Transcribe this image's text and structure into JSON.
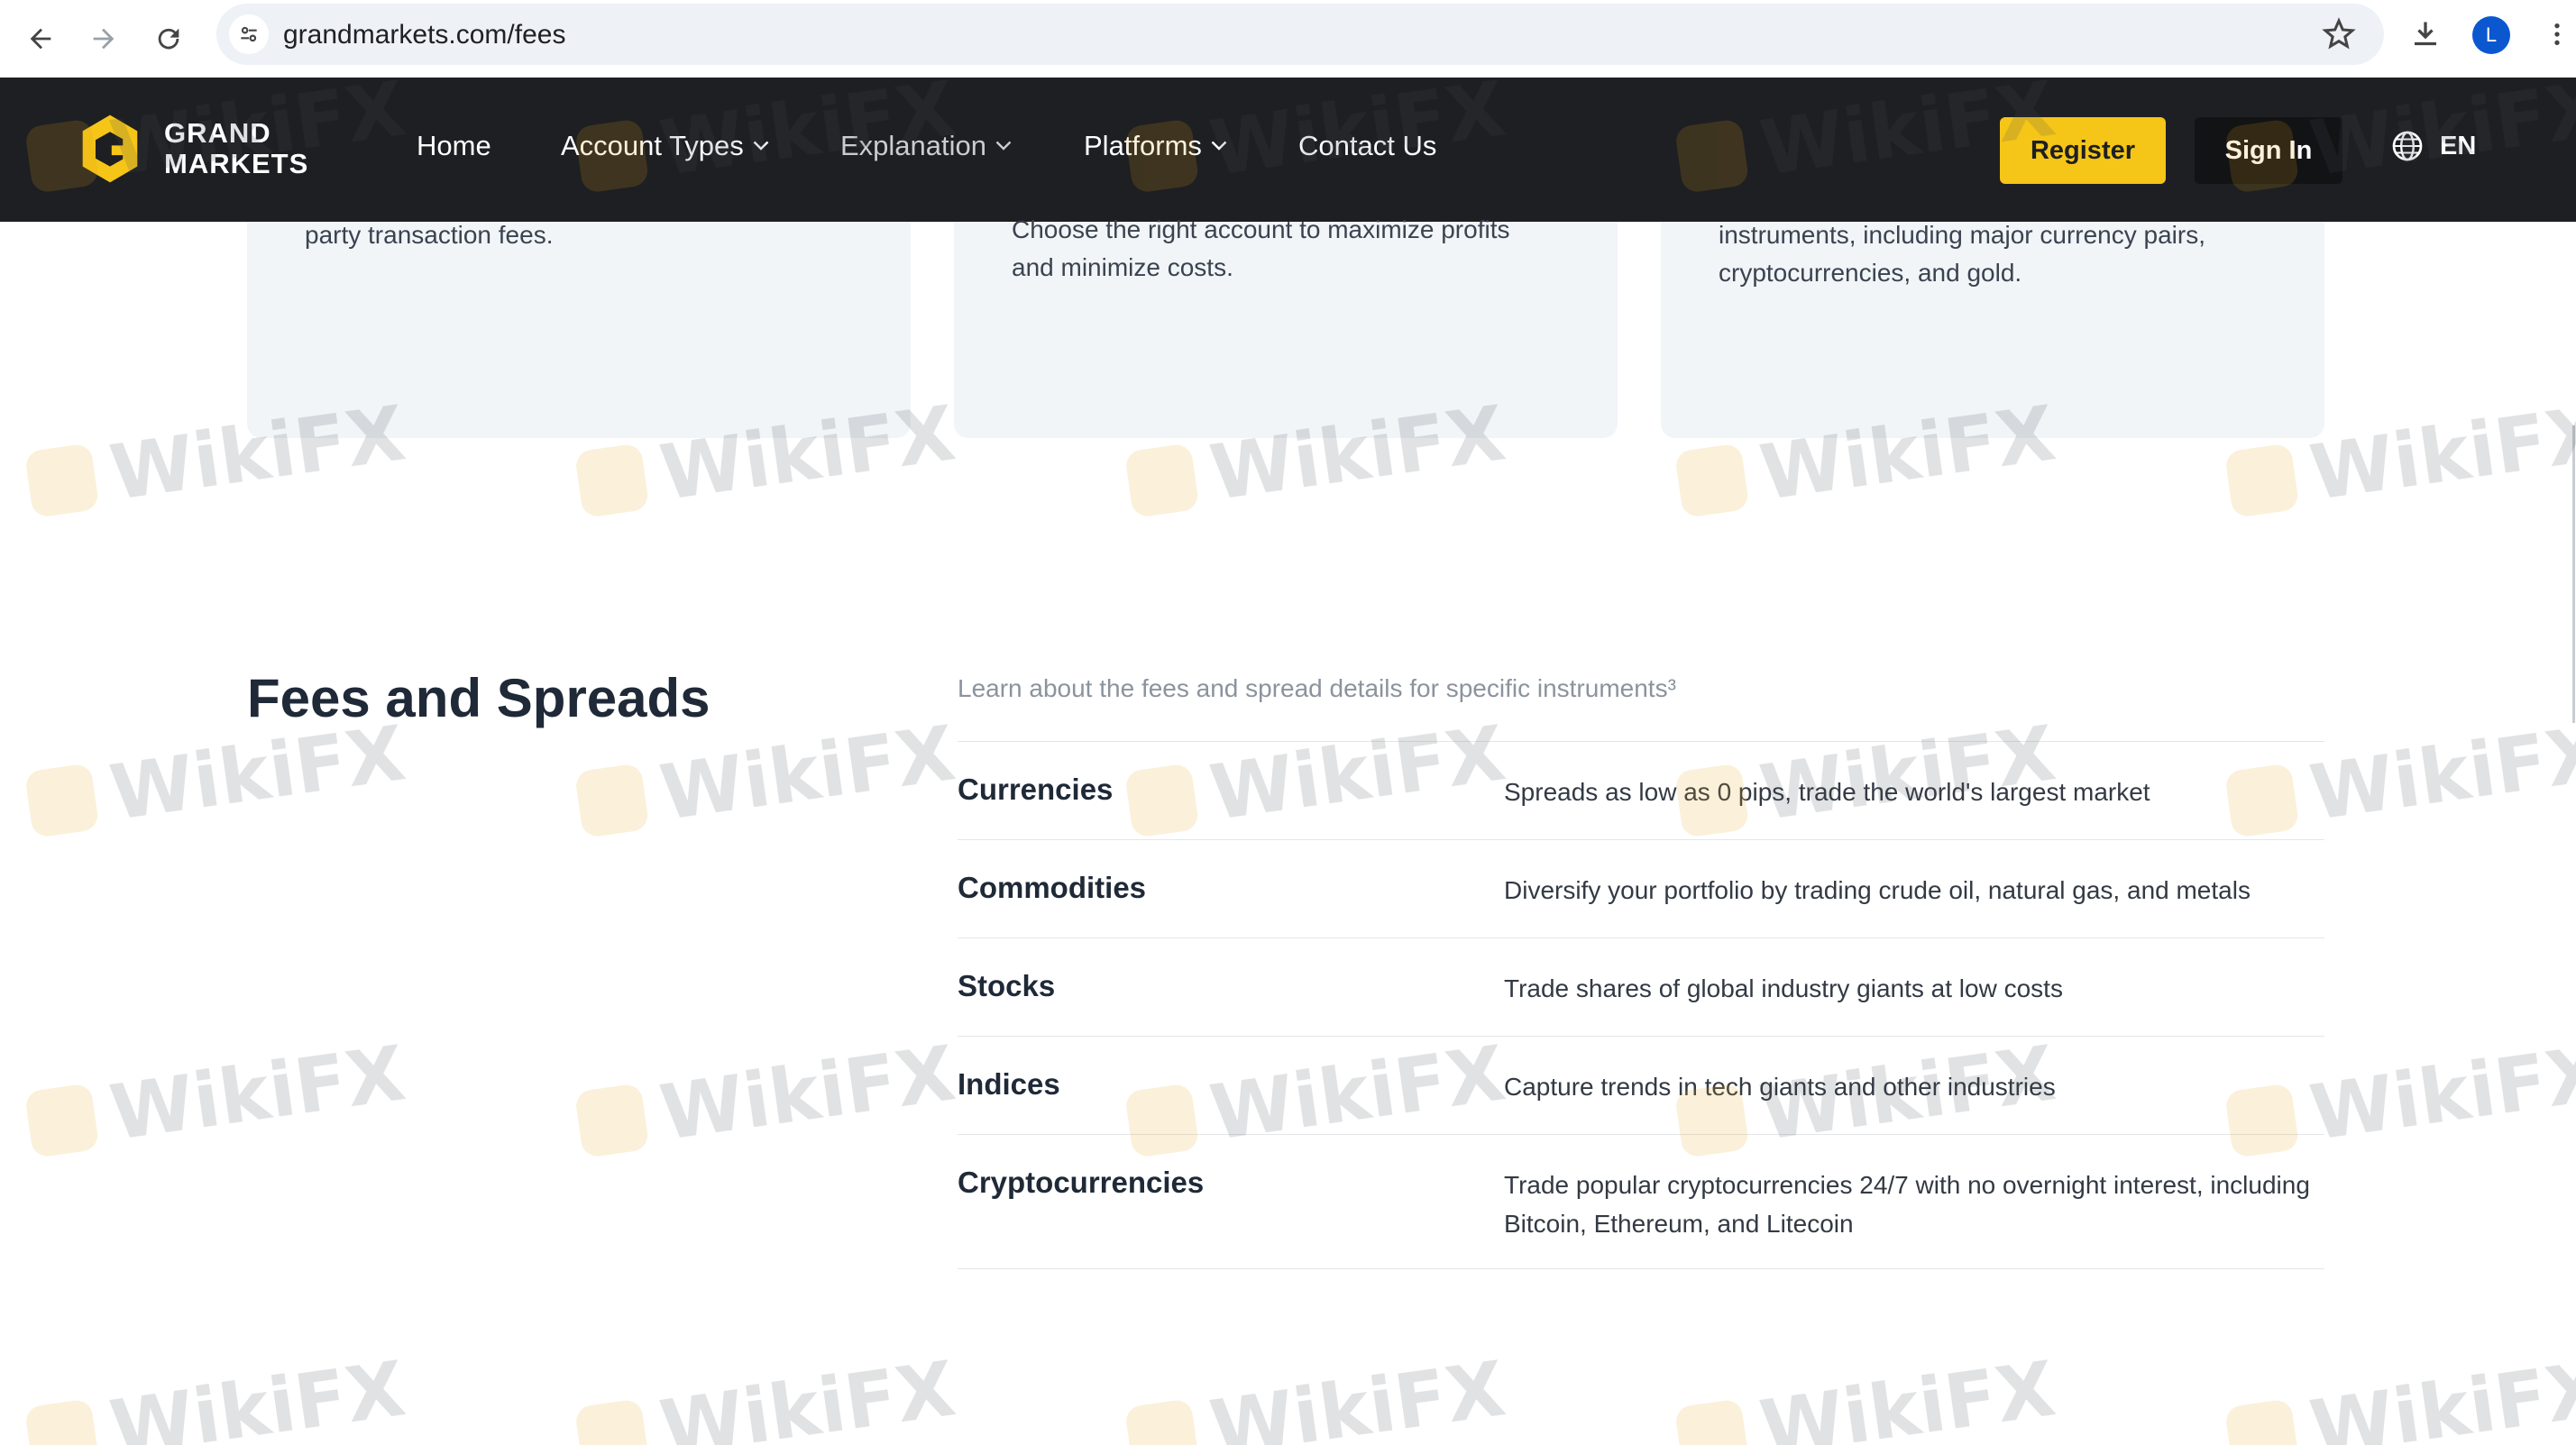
{
  "browser": {
    "url": "grandmarkets.com/fees",
    "avatar_initial": "L"
  },
  "header": {
    "logo_line1": "GRAND",
    "logo_line2": "MARKETS",
    "menu": [
      {
        "label": "Home",
        "has_dropdown": false
      },
      {
        "label": "Account Types",
        "has_dropdown": true
      },
      {
        "label": "Explanation",
        "has_dropdown": true
      },
      {
        "label": "Platforms",
        "has_dropdown": true
      },
      {
        "label": "Contact Us",
        "has_dropdown": false
      }
    ],
    "register_label": "Register",
    "signin_label": "Sign In",
    "language": "EN",
    "accent_color": "#f5c518",
    "background_color": "#1d1f22"
  },
  "cards": [
    {
      "lines": [
        "party transaction fees."
      ]
    },
    {
      "lines": [
        "Choose the right account to maximize profits",
        "and minimize costs."
      ]
    },
    {
      "lines": [
        "instruments, including major currency pairs,",
        "cryptocurrencies, and gold."
      ]
    }
  ],
  "fees": {
    "title": "Fees and Spreads",
    "subtitle": "Learn about the fees and spread details for specific instruments³",
    "rows": [
      {
        "name": "Currencies",
        "description": "Spreads as low as 0 pips, trade the world's largest market"
      },
      {
        "name": "Commodities",
        "description": "Diversify your portfolio by trading crude oil, natural gas, and metals"
      },
      {
        "name": "Stocks",
        "description": "Trade shares of global industry giants at low costs"
      },
      {
        "name": "Indices",
        "description": "Capture trends in tech giants and other industries"
      },
      {
        "name": "Cryptocurrencies",
        "description": "Trade popular cryptocurrencies 24/7 with no overnight interest, including Bitcoin, Ethereum, and Litecoin"
      }
    ]
  },
  "watermark": {
    "text": "WikiFX"
  }
}
